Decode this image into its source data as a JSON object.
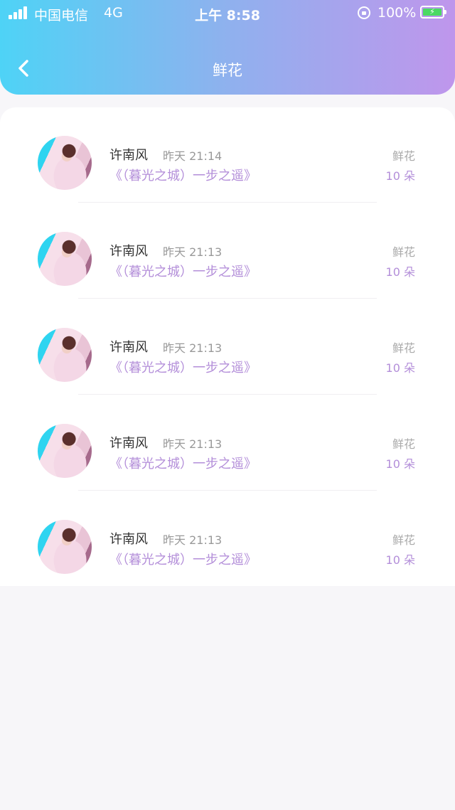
{
  "status_bar": {
    "carrier": "中国电信",
    "network": "4G",
    "time": "上午 8:58",
    "battery_percent": "100%",
    "battery_level": 1.0,
    "signal_bars": 4
  },
  "header": {
    "title": "鲜花",
    "back_icon": "chevron-left-icon"
  },
  "records": [
    {
      "name": "许南风",
      "time": "昨天 21:14",
      "book": "《（暮光之城）一步之遥》",
      "gift_type": "鲜花",
      "gift_count": "10 朵"
    },
    {
      "name": "许南风",
      "time": "昨天 21:13",
      "book": "《（暮光之城）一步之遥》",
      "gift_type": "鲜花",
      "gift_count": "10 朵"
    },
    {
      "name": "许南风",
      "time": "昨天 21:13",
      "book": "《（暮光之城）一步之遥》",
      "gift_type": "鲜花",
      "gift_count": "10 朵"
    },
    {
      "name": "许南风",
      "time": "昨天 21:13",
      "book": "《（暮光之城）一步之遥》",
      "gift_type": "鲜花",
      "gift_count": "10 朵"
    },
    {
      "name": "许南风",
      "time": "昨天 21:13",
      "book": "《（暮光之城）一步之遥》",
      "gift_type": "鲜花",
      "gift_count": "10 朵"
    }
  ],
  "colors": {
    "header_gradient_start": "#4ed3f6",
    "header_gradient_end": "#bf96ec",
    "accent_purple": "#b38ed9"
  }
}
